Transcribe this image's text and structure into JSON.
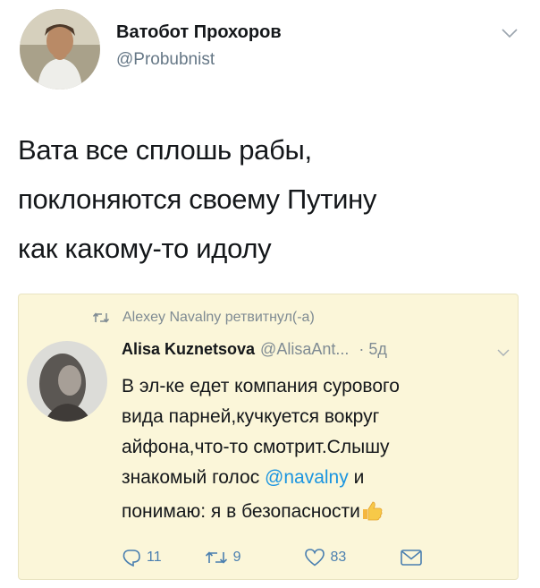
{
  "tweet": {
    "author_name": "Ватобот Прохоров",
    "author_handle": "@Probubnist",
    "text_lines": [
      "Вата все сплошь рабы,",
      "поклоняются своему Путину",
      "как какому-то идолу"
    ]
  },
  "quoted": {
    "retweet_label": "Alexey Navalny ретвитнул(-а)",
    "author_name": "Alisa Kuznetsova",
    "author_handle": "@AlisaAnt...",
    "time": "· 5д",
    "text_lines": [
      "В эл-ке едет компания сурового",
      "вида парней,кучкуется вокруг",
      "айфона,что-то смотрит.Слышу"
    ],
    "line4_before": "знакомый голос ",
    "mention": "@navalny",
    "line4_after": " и",
    "line5": "понимаю: я в безопасности",
    "actions": {
      "replies": "11",
      "retweets": "9",
      "likes": "83"
    },
    "icons": [
      "retweet-icon",
      "reply-icon",
      "like-icon",
      "message-icon",
      "thumbs-up-icon"
    ],
    "accent": "#1b95e0",
    "card_bg": "#fbf6d9"
  }
}
